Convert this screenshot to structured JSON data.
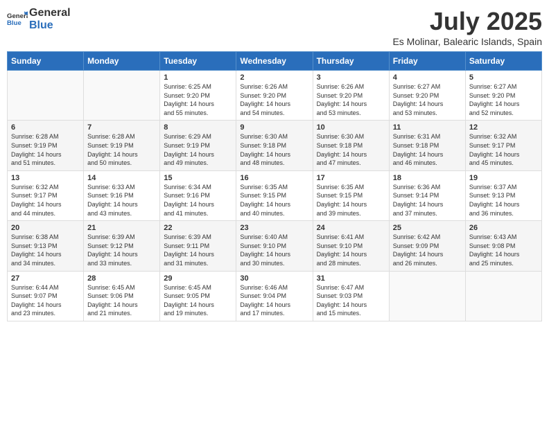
{
  "header": {
    "logo_general": "General",
    "logo_blue": "Blue",
    "title": "July 2025",
    "subtitle": "Es Molinar, Balearic Islands, Spain"
  },
  "weekdays": [
    "Sunday",
    "Monday",
    "Tuesday",
    "Wednesday",
    "Thursday",
    "Friday",
    "Saturday"
  ],
  "weeks": [
    [
      {
        "day": "",
        "info": ""
      },
      {
        "day": "",
        "info": ""
      },
      {
        "day": "1",
        "info": "Sunrise: 6:25 AM\nSunset: 9:20 PM\nDaylight: 14 hours\nand 55 minutes."
      },
      {
        "day": "2",
        "info": "Sunrise: 6:26 AM\nSunset: 9:20 PM\nDaylight: 14 hours\nand 54 minutes."
      },
      {
        "day": "3",
        "info": "Sunrise: 6:26 AM\nSunset: 9:20 PM\nDaylight: 14 hours\nand 53 minutes."
      },
      {
        "day": "4",
        "info": "Sunrise: 6:27 AM\nSunset: 9:20 PM\nDaylight: 14 hours\nand 53 minutes."
      },
      {
        "day": "5",
        "info": "Sunrise: 6:27 AM\nSunset: 9:20 PM\nDaylight: 14 hours\nand 52 minutes."
      }
    ],
    [
      {
        "day": "6",
        "info": "Sunrise: 6:28 AM\nSunset: 9:19 PM\nDaylight: 14 hours\nand 51 minutes."
      },
      {
        "day": "7",
        "info": "Sunrise: 6:28 AM\nSunset: 9:19 PM\nDaylight: 14 hours\nand 50 minutes."
      },
      {
        "day": "8",
        "info": "Sunrise: 6:29 AM\nSunset: 9:19 PM\nDaylight: 14 hours\nand 49 minutes."
      },
      {
        "day": "9",
        "info": "Sunrise: 6:30 AM\nSunset: 9:18 PM\nDaylight: 14 hours\nand 48 minutes."
      },
      {
        "day": "10",
        "info": "Sunrise: 6:30 AM\nSunset: 9:18 PM\nDaylight: 14 hours\nand 47 minutes."
      },
      {
        "day": "11",
        "info": "Sunrise: 6:31 AM\nSunset: 9:18 PM\nDaylight: 14 hours\nand 46 minutes."
      },
      {
        "day": "12",
        "info": "Sunrise: 6:32 AM\nSunset: 9:17 PM\nDaylight: 14 hours\nand 45 minutes."
      }
    ],
    [
      {
        "day": "13",
        "info": "Sunrise: 6:32 AM\nSunset: 9:17 PM\nDaylight: 14 hours\nand 44 minutes."
      },
      {
        "day": "14",
        "info": "Sunrise: 6:33 AM\nSunset: 9:16 PM\nDaylight: 14 hours\nand 43 minutes."
      },
      {
        "day": "15",
        "info": "Sunrise: 6:34 AM\nSunset: 9:16 PM\nDaylight: 14 hours\nand 41 minutes."
      },
      {
        "day": "16",
        "info": "Sunrise: 6:35 AM\nSunset: 9:15 PM\nDaylight: 14 hours\nand 40 minutes."
      },
      {
        "day": "17",
        "info": "Sunrise: 6:35 AM\nSunset: 9:15 PM\nDaylight: 14 hours\nand 39 minutes."
      },
      {
        "day": "18",
        "info": "Sunrise: 6:36 AM\nSunset: 9:14 PM\nDaylight: 14 hours\nand 37 minutes."
      },
      {
        "day": "19",
        "info": "Sunrise: 6:37 AM\nSunset: 9:13 PM\nDaylight: 14 hours\nand 36 minutes."
      }
    ],
    [
      {
        "day": "20",
        "info": "Sunrise: 6:38 AM\nSunset: 9:13 PM\nDaylight: 14 hours\nand 34 minutes."
      },
      {
        "day": "21",
        "info": "Sunrise: 6:39 AM\nSunset: 9:12 PM\nDaylight: 14 hours\nand 33 minutes."
      },
      {
        "day": "22",
        "info": "Sunrise: 6:39 AM\nSunset: 9:11 PM\nDaylight: 14 hours\nand 31 minutes."
      },
      {
        "day": "23",
        "info": "Sunrise: 6:40 AM\nSunset: 9:10 PM\nDaylight: 14 hours\nand 30 minutes."
      },
      {
        "day": "24",
        "info": "Sunrise: 6:41 AM\nSunset: 9:10 PM\nDaylight: 14 hours\nand 28 minutes."
      },
      {
        "day": "25",
        "info": "Sunrise: 6:42 AM\nSunset: 9:09 PM\nDaylight: 14 hours\nand 26 minutes."
      },
      {
        "day": "26",
        "info": "Sunrise: 6:43 AM\nSunset: 9:08 PM\nDaylight: 14 hours\nand 25 minutes."
      }
    ],
    [
      {
        "day": "27",
        "info": "Sunrise: 6:44 AM\nSunset: 9:07 PM\nDaylight: 14 hours\nand 23 minutes."
      },
      {
        "day": "28",
        "info": "Sunrise: 6:45 AM\nSunset: 9:06 PM\nDaylight: 14 hours\nand 21 minutes."
      },
      {
        "day": "29",
        "info": "Sunrise: 6:45 AM\nSunset: 9:05 PM\nDaylight: 14 hours\nand 19 minutes."
      },
      {
        "day": "30",
        "info": "Sunrise: 6:46 AM\nSunset: 9:04 PM\nDaylight: 14 hours\nand 17 minutes."
      },
      {
        "day": "31",
        "info": "Sunrise: 6:47 AM\nSunset: 9:03 PM\nDaylight: 14 hours\nand 15 minutes."
      },
      {
        "day": "",
        "info": ""
      },
      {
        "day": "",
        "info": ""
      }
    ]
  ]
}
